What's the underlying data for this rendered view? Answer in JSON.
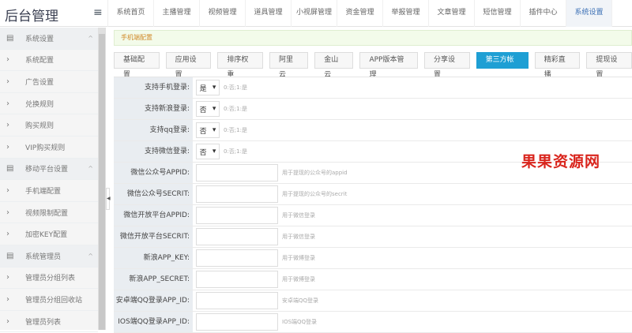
{
  "header": {
    "logo": "后台管理",
    "tabs": [
      "系统首页",
      "主播管理",
      "视频管理",
      "道具管理",
      "小视屏管理",
      "资金管理",
      "举报管理",
      "文章管理",
      "短信管理",
      "插件中心",
      "系统设置"
    ],
    "active_tab": 10
  },
  "sidebar": {
    "items": [
      {
        "label": "系统设置",
        "group": true
      },
      {
        "label": "系统配置"
      },
      {
        "label": "广告设置"
      },
      {
        "label": "兑换规则"
      },
      {
        "label": "购买规则"
      },
      {
        "label": "VIP购买规则"
      },
      {
        "label": "移动平台设置",
        "group": true
      },
      {
        "label": "手机端配置"
      },
      {
        "label": "视频限制配置"
      },
      {
        "label": "加密KEY配置"
      },
      {
        "label": "系统管理员",
        "group": true
      },
      {
        "label": "管理员分组列表"
      },
      {
        "label": "管理员分组回收站"
      },
      {
        "label": "管理员列表"
      }
    ]
  },
  "notice": "手机端配置",
  "buttons": [
    "基础配置",
    "应用设置",
    "排序权重",
    "阿里云",
    "金山云",
    "APP版本管理",
    "分享设置",
    "第三方帐户",
    "精彩直播",
    "提现设置"
  ],
  "active_button": 7,
  "form": {
    "selects": [
      {
        "label": "支持手机登录:",
        "value": "是",
        "hint": "0:否;1:是"
      },
      {
        "label": "支持新浪登录:",
        "value": "否",
        "hint": "0:否;1:是"
      },
      {
        "label": "支持qq登录:",
        "value": "否",
        "hint": "0:否;1:是"
      },
      {
        "label": "支持微信登录:",
        "value": "否",
        "hint": "0:否;1:是"
      }
    ],
    "inputs": [
      {
        "label": "微信公众号APPID:",
        "value": "",
        "hint": "用于提现的公众号的appid"
      },
      {
        "label": "微信公众号SECRIT:",
        "value": "",
        "hint": "用于提现的公众号的secrit"
      },
      {
        "label": "微信开放平台APPID:",
        "value": "",
        "hint": "用于微信登录"
      },
      {
        "label": "微信开放平台SECRIT:",
        "value": "",
        "hint": "用于微信登录"
      },
      {
        "label": "新浪APP_KEY:",
        "value": "",
        "hint": "用于微博登录"
      },
      {
        "label": "新浪APP_SECRET:",
        "value": "",
        "hint": "用于微博登录"
      },
      {
        "label": "安卓端QQ登录APP_ID:",
        "value": "",
        "hint": "安卓端QQ登录"
      },
      {
        "label": "IOS端QQ登录APP_ID:",
        "value": "",
        "hint": "IOS端QQ登录"
      }
    ]
  },
  "watermark": "果果资源网"
}
